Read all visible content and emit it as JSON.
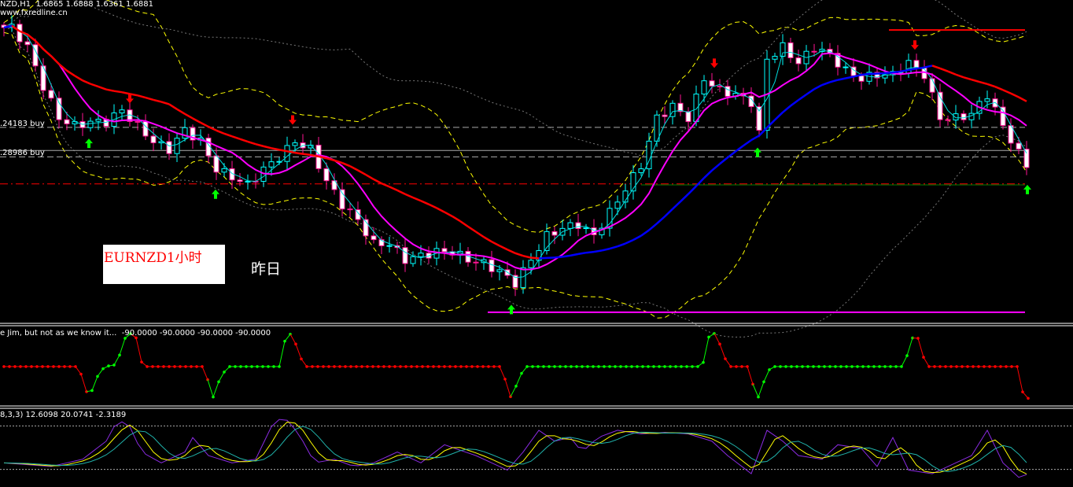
{
  "header": {
    "symbol": "NZD,H1",
    "ohlc": "1.6865 1.6888 1.6361 1.6881",
    "watermark": "www.fxredline.cn"
  },
  "levels": [
    {
      "label": ".24183 buy"
    },
    {
      "label": ".28986 buy"
    }
  ],
  "annotation": {
    "box_text": "EURNZD1小时",
    "side_text": "昨日"
  },
  "indicator1": {
    "title": "e Jim, but not as we know it...",
    "values": "-90.0000 -90.0000 -90.0000 -90.0000"
  },
  "indicator2": {
    "title": "8,3,3)",
    "values": "12.6098 20.0741 -2.3189"
  },
  "colors": {
    "bull": "#00ffff",
    "bear": "#ff1493",
    "ma_fall": "#ff0000",
    "ma_rise": "#0000ff",
    "ma_mid": "#ff00ff",
    "ma_fast": "#00e0e0",
    "band": "#ffff00",
    "up_arrow": "#00ff00",
    "down_arrow": "#ff0000",
    "stoch_main": "#8a2be2",
    "stoch_signal": "#ffff00",
    "stoch_third": "#20b2aa"
  },
  "chart_data": {
    "type": "candlestick",
    "title": "EURNZD H1",
    "price_keyframes": {
      "bar": [
        1,
        3,
        5,
        7,
        9,
        11,
        13,
        15,
        17,
        19,
        21,
        23,
        25,
        27,
        29,
        31,
        33,
        35,
        37,
        39,
        41,
        43,
        45,
        47,
        49,
        51,
        53,
        55,
        57,
        59,
        61,
        63,
        65,
        67,
        69,
        71,
        73,
        75,
        77,
        79,
        81,
        83,
        85,
        87,
        89,
        91,
        93,
        95,
        96,
        97,
        99,
        101,
        103,
        105,
        107,
        109,
        111,
        113,
        115,
        117,
        119,
        121,
        123,
        125,
        127,
        129,
        130
      ],
      "close": [
        1.6944,
        1.6904,
        1.6824,
        1.676,
        1.6744,
        1.6752,
        1.6752,
        1.6776,
        1.6744,
        1.6712,
        1.6696,
        1.6736,
        1.6712,
        1.6656,
        1.664,
        1.6624,
        1.6656,
        1.668,
        1.6712,
        1.6696,
        1.6632,
        1.6584,
        1.6552,
        1.6504,
        1.6504,
        1.6472,
        1.648,
        1.6488,
        1.6488,
        1.6472,
        1.6464,
        1.6448,
        1.6424,
        1.6472,
        1.652,
        1.6536,
        1.6544,
        1.652,
        1.6568,
        1.6616,
        1.6664,
        1.676,
        1.6784,
        1.676,
        1.684,
        1.6816,
        1.6808,
        1.6792,
        1.6728,
        1.688,
        1.6904,
        1.6872,
        1.6904,
        1.6888,
        1.6856,
        1.684,
        1.6848,
        1.6848,
        1.6872,
        1.6848,
        1.676,
        1.676,
        1.6768,
        1.6808,
        1.6744,
        1.6688,
        1.6664
      ]
    },
    "ylim": [
      1.6344,
      1.7
    ],
    "hlines": [
      {
        "price": 1.6741,
        "style": "dash",
        "color": "#aaaaaa"
      },
      {
        "price": 1.6694,
        "style": "solid",
        "color": "#aaaaaa"
      },
      {
        "price": 1.6681,
        "style": "dash",
        "color": "#aaaaaa"
      },
      {
        "price": 1.6626,
        "style": "dashdot",
        "color": "#ff0000"
      },
      {
        "price": 1.6624,
        "style": "solid",
        "color": "#008000",
        "from_bar": 81
      },
      {
        "price": 1.6365,
        "style": "solid",
        "color": "#ff00ff",
        "from_bar": 61.5
      },
      {
        "price": 1.6939,
        "style": "solid",
        "color": "#ff0000",
        "from_bar": 112.5
      }
    ],
    "signals": [
      {
        "bar": 16,
        "type": "sell"
      },
      {
        "bar": 36.7,
        "type": "sell"
      },
      {
        "bar": 90.3,
        "type": "sell"
      },
      {
        "bar": 115.8,
        "type": "sell"
      },
      {
        "bar": 10.8,
        "type": "buy"
      },
      {
        "bar": 26.9,
        "type": "buy"
      },
      {
        "bar": 64.5,
        "type": "buy"
      },
      {
        "bar": 95.8,
        "type": "buy"
      },
      {
        "bar": 130.1,
        "type": "buy"
      }
    ],
    "indicator1": {
      "bar": [
        0,
        9.5,
        10.8,
        11.8,
        12.8,
        14.5,
        15,
        16,
        16.7,
        17.2,
        18,
        25.5,
        26.5,
        27.5,
        28.5,
        35,
        35.8,
        36.7,
        37.5,
        38.5,
        63.2,
        64.5,
        65.5,
        66.3,
        88.8,
        89.5,
        90.5,
        91.5,
        92.2,
        94.5,
        95.8,
        96.8,
        97.5,
        114.5,
        115.2,
        116,
        116.8,
        117.5,
        128.8,
        129.5,
        130.3
      ],
      "value": [
        -90,
        -90,
        -135,
        -105,
        -90,
        -87,
        -55,
        -45,
        -43,
        -80,
        -90,
        -90,
        -135,
        -105,
        -90,
        -90,
        -50,
        -43,
        -75,
        -90,
        -90,
        -135,
        -105,
        -90,
        -90,
        -50,
        -43,
        -75,
        -90,
        -90,
        -135,
        -105,
        -90,
        -90,
        -55,
        -43,
        -75,
        -90,
        -90,
        -125,
        -135
      ],
      "ylim": [
        -140,
        -38
      ]
    },
    "indicator2": {
      "bar": [
        0,
        6,
        10,
        13,
        14.5,
        16,
        17.5,
        20,
        23,
        24,
        26,
        29,
        32,
        34,
        35.5,
        37.5,
        39.5,
        42,
        44.5,
        47,
        50,
        53,
        56,
        60,
        64,
        66,
        68,
        70,
        72,
        73.5,
        75.5,
        78,
        81,
        84,
        87,
        90,
        92,
        95,
        97,
        99,
        101,
        104,
        106,
        109,
        111,
        113,
        115,
        118,
        121,
        123,
        125,
        127,
        129,
        130.3
      ],
      "value": [
        29,
        24,
        34,
        59,
        89,
        79,
        44,
        29,
        44,
        64,
        39,
        29,
        34,
        79,
        94,
        69,
        29,
        34,
        24,
        29,
        44,
        29,
        54,
        39,
        19,
        44,
        74,
        59,
        64,
        44,
        64,
        74,
        69,
        71,
        69,
        59,
        39,
        14,
        74,
        59,
        39,
        34,
        54,
        49,
        24,
        64,
        19,
        14,
        29,
        39,
        74,
        29,
        9,
        14
      ],
      "ylim": [
        0,
        100
      ],
      "levels": [
        80,
        20
      ]
    }
  }
}
